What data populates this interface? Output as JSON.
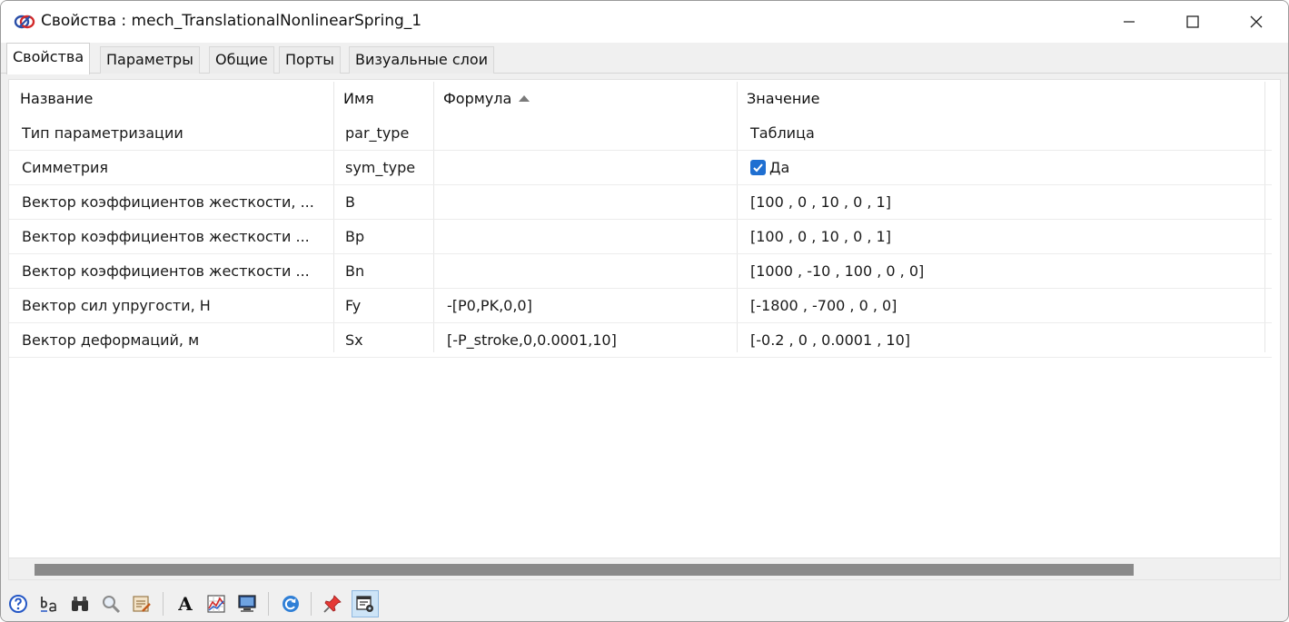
{
  "window": {
    "title": "Свойства : mech_TranslationalNonlinearSpring_1"
  },
  "tabs": [
    {
      "label": "Свойства",
      "active": true
    },
    {
      "label": "Параметры",
      "active": false
    },
    {
      "label": "Общие",
      "active": false
    },
    {
      "label": "Порты",
      "active": false
    },
    {
      "label": "Визуальные слои",
      "active": false
    }
  ],
  "table": {
    "headers": {
      "name": "Название",
      "id": "Имя",
      "formula": "Формула",
      "value": "Значение"
    },
    "sorted_column": "formula",
    "rows": [
      {
        "name": "Тип параметризации",
        "id": "par_type",
        "formula": "",
        "value": "Таблица",
        "checkbox": false
      },
      {
        "name": "Симметрия",
        "id": "sym_type",
        "formula": "",
        "value": "Да",
        "checkbox": true
      },
      {
        "name": "Вектор коэффициентов жесткости, ...",
        "id": "B",
        "formula": "",
        "value": "[100 , 0 , 10 , 0 , 1]",
        "checkbox": false
      },
      {
        "name": "Вектор коэффициентов жесткости ...",
        "id": "Bp",
        "formula": "",
        "value": "[100 , 0 , 10 , 0 , 1]",
        "checkbox": false
      },
      {
        "name": "Вектор коэффициентов жесткости ...",
        "id": "Bn",
        "formula": "",
        "value": "[1000 , -10 , 100 , 0 , 0]",
        "checkbox": false
      },
      {
        "name": "Вектор сил упругости, Н",
        "id": "Fy",
        "formula": "-[P0,PK,0,0]",
        "value": "[-1800 , -700 , 0 , 0]",
        "checkbox": false
      },
      {
        "name": "Вектор деформаций, м",
        "id": "Sx",
        "formula": "[-P_stroke,0,0.0001,10]",
        "value": "[-0.2 , 0 , 0.0001 , 10]",
        "checkbox": false
      }
    ]
  },
  "toolbar": {
    "items": [
      "help-icon",
      "sort-ba-icon",
      "binoculars-icon",
      "magnifier-icon",
      "edit-properties-icon",
      "font-icon",
      "chart-icon",
      "monitor-icon",
      "refresh-icon",
      "pin-icon",
      "window-settings-icon"
    ],
    "text_glyph": "A"
  },
  "colors": {
    "accent": "#1f6fd1",
    "scroll_thumb": "#8a8a8a"
  }
}
